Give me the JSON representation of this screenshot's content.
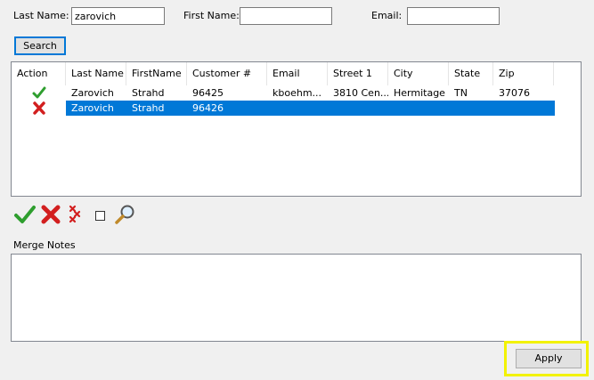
{
  "search_form": {
    "last_name_label": "Last Name:",
    "last_name_value": "zarovich",
    "first_name_label": "First Name:",
    "first_name_value": "",
    "email_label": "Email:",
    "email_value": "",
    "search_button": "Search"
  },
  "grid": {
    "columns": [
      "Action",
      "Last Name",
      "FirstName",
      "Customer #",
      "Email",
      "Street 1",
      "City",
      "State",
      "Zip"
    ],
    "rows": [
      {
        "action_icon": "green-check-icon",
        "last_name": "Zarovich",
        "first_name": "Strahd",
        "customer_no": "96425",
        "email": "kboehm...",
        "street1": "3810 Cen...",
        "city": "Hermitage",
        "state": "TN",
        "zip": "37076",
        "selected": false
      },
      {
        "action_icon": "red-x-icon",
        "last_name": "Zarovich",
        "first_name": "Strahd",
        "customer_no": "96426",
        "email": "",
        "street1": "",
        "city": "",
        "state": "",
        "zip": "",
        "selected": true
      }
    ]
  },
  "toolbar": {
    "icons": [
      "green-check-icon",
      "red-x-icon",
      "small-red-x-icon",
      "checkbox",
      "magnifier-icon"
    ]
  },
  "merge_notes": {
    "label": "Merge Notes",
    "value": ""
  },
  "apply_button": "Apply",
  "colors": {
    "selection": "#0078d7",
    "highlight": "#f2f200",
    "check_green": "#2e9e2e",
    "x_red": "#d21f1f"
  }
}
